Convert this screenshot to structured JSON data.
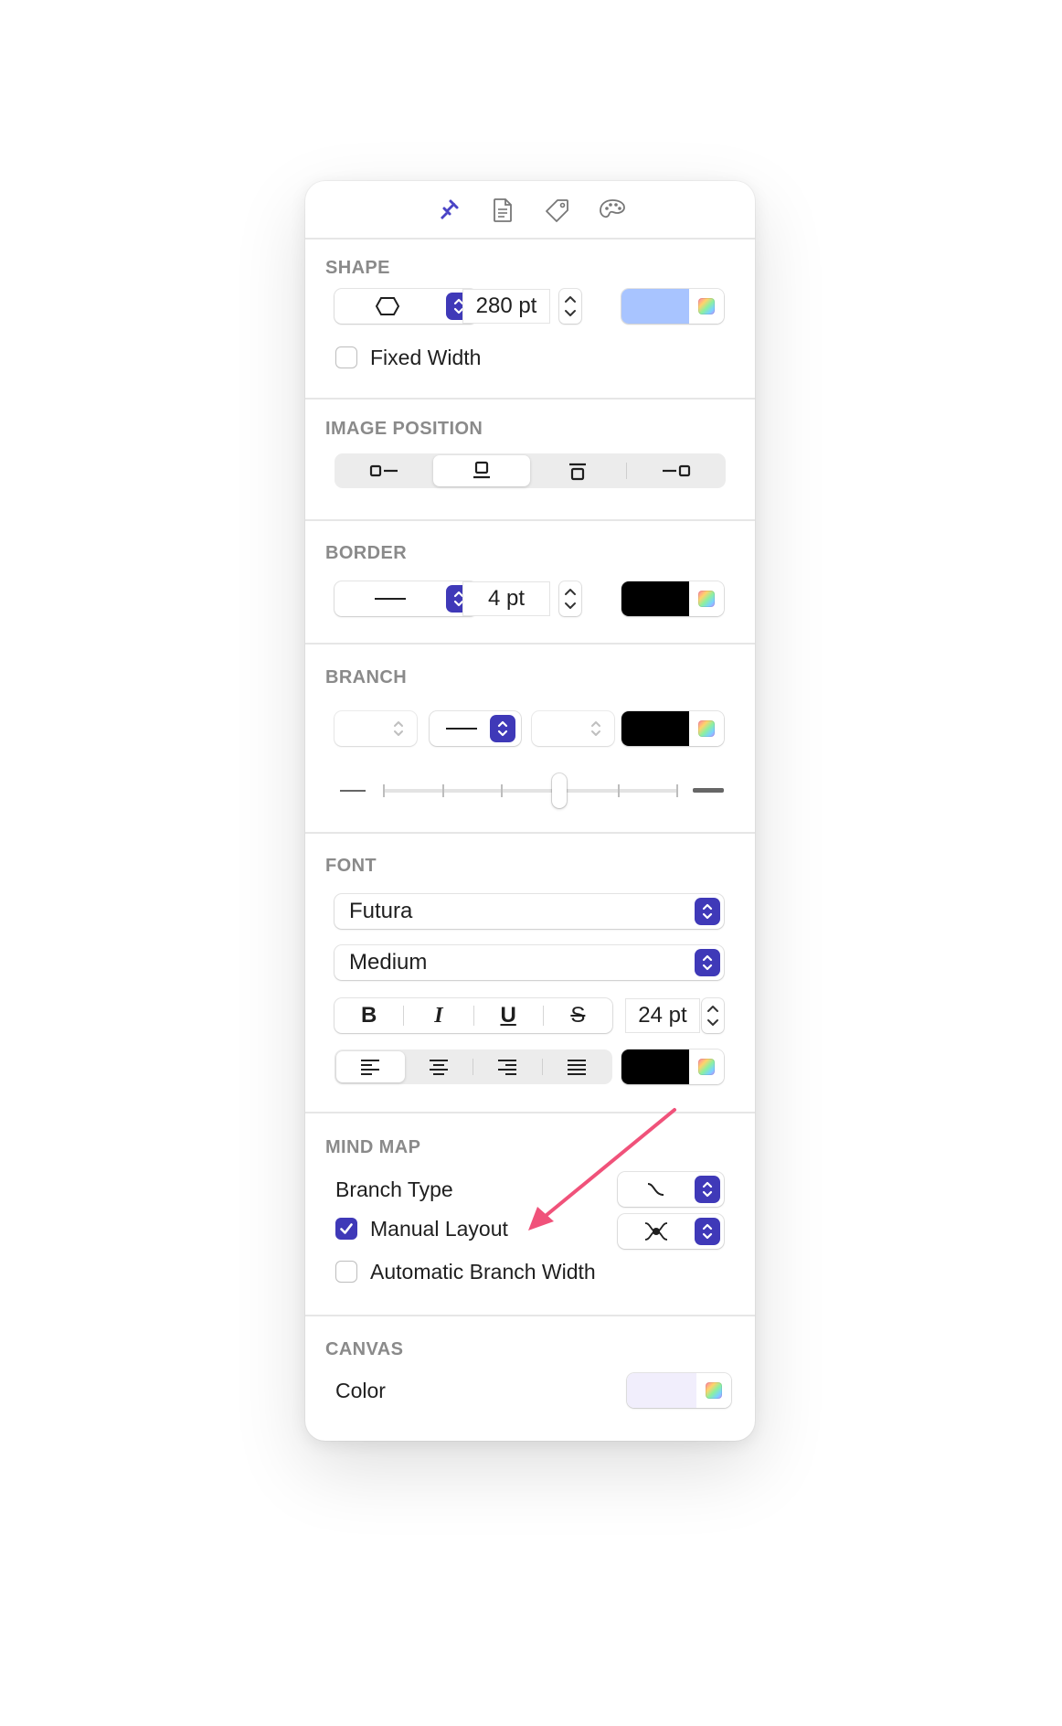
{
  "toolbar": {
    "tabs": [
      {
        "icon": "style-brush-icon",
        "selected": true
      },
      {
        "icon": "document-icon",
        "selected": false
      },
      {
        "icon": "tag-icon",
        "selected": false
      },
      {
        "icon": "palette-icon",
        "selected": false
      }
    ]
  },
  "shape": {
    "label": "SHAPE",
    "shape_icon": "hexagon-icon",
    "size_value": "280 pt",
    "fill_color": "#a8c4ff",
    "fixed_width_label": "Fixed Width",
    "fixed_width_checked": false
  },
  "image_position": {
    "label": "IMAGE POSITION",
    "options": [
      "image-left",
      "image-bottom",
      "image-top",
      "image-right"
    ],
    "selected_index": 1
  },
  "border": {
    "label": "BORDER",
    "line_style": "solid-line",
    "width_value": "4 pt",
    "color": "#000000"
  },
  "branch": {
    "label": "BRANCH",
    "line_style": "solid-line",
    "color": "#000000",
    "thickness_slider_position": 0.6
  },
  "font": {
    "label": "FONT",
    "family": "Futura",
    "weight": "Medium",
    "bold_label": "B",
    "italic_label": "I",
    "underline_label": "U",
    "strike_label": "S",
    "size_value": "24 pt",
    "alignment_selected": "left",
    "color": "#000000"
  },
  "mind_map": {
    "label": "MIND MAP",
    "branch_type_label": "Branch Type",
    "manual_layout_label": "Manual Layout",
    "manual_layout_checked": true,
    "auto_branch_width_label": "Automatic Branch Width",
    "auto_branch_width_checked": false
  },
  "canvas": {
    "label": "CANVAS",
    "color_label": "Color",
    "color": "#f1eefc"
  },
  "annotation": {
    "arrow_color": "#f0527a"
  }
}
